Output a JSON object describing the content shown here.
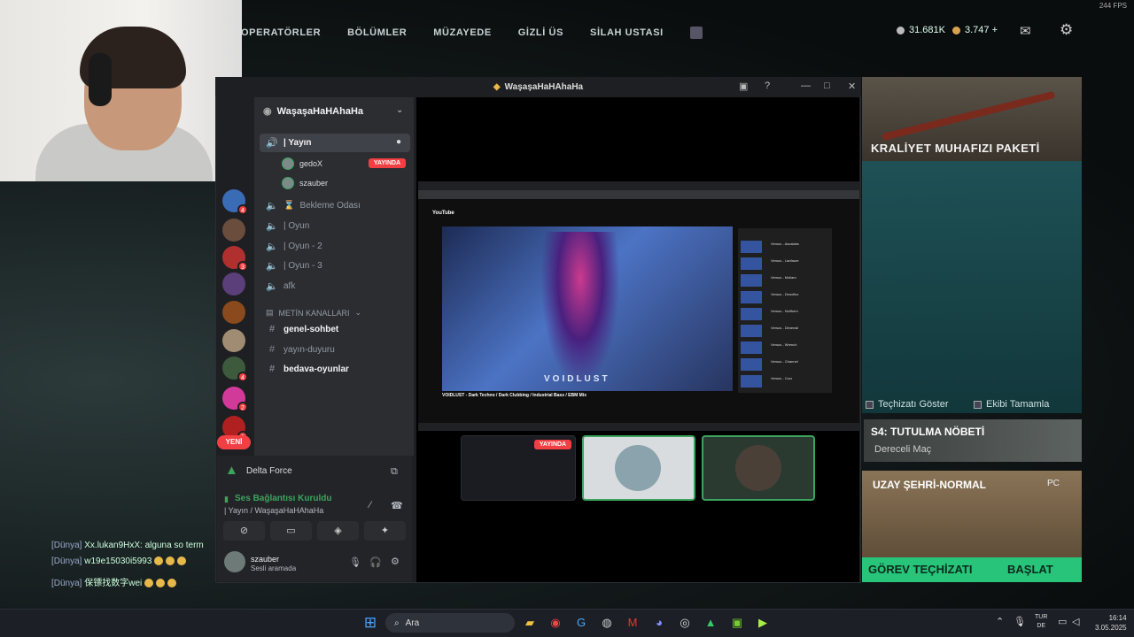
{
  "game": {
    "fps": "244 FPS",
    "nav": [
      "OPERATÖRLER",
      "BÖLÜMLER",
      "MÜZAYEDE",
      "GİZLİ ÜS",
      "SİLAH USTASI"
    ],
    "currency1": "31.681K",
    "currency2": "3.747 +",
    "bundle_title": "KRALİYET MUHAFIZI PAKETİ",
    "show_gear": "Teçhizatı Göster",
    "fill_team": "Ekibi Tamamla",
    "tutorial_title": "S4: TUTULMA NÖBETİ",
    "tutorial_sub": "Dereceli Maç",
    "mode_title": "UZAY ŞEHRİ-NORMAL",
    "mode_platform": "PC",
    "gear_label": "GÖREV TEÇHİZATI",
    "start_label": "BAŞLAT",
    "chat": [
      {
        "prefix": "[Dünya]",
        "text": "Xx.lukan9HxX: alguna so term"
      },
      {
        "prefix": "[Dünya]",
        "text": "w19e15030i5993"
      },
      {
        "prefix": "[Dünya]",
        "text": "保镖找数字wei"
      }
    ]
  },
  "discord": {
    "window_title": "WaşaşaHaHAhaHa",
    "server_name": "WaşaşaHaHAhaHa",
    "channels": {
      "yayin": "| Yayın",
      "bekleme": "Bekleme Odası",
      "oyun": "| Oyun",
      "oyun2": "| Oyun - 2",
      "oyun3": "| Oyun - 3",
      "afk": "afk",
      "text_category": "METİN KANALLARI",
      "genel": "genel-sohbet",
      "duyuru": "yayın-duyuru",
      "bedava": "bedava-oyunlar"
    },
    "voice_users": [
      {
        "name": "gedoX",
        "badge": "YAYINDA"
      },
      {
        "name": "szauber",
        "badge": ""
      }
    ],
    "guild_badges": [
      "4",
      "3",
      "4",
      "2",
      "1"
    ],
    "new_label": "YENİ",
    "activity": "Delta Force",
    "voice_status": "Ses Bağlantısı Kuruldu",
    "voice_channel": "| Yayın / WaşaşaHaHAhaHa",
    "user_name": "szauber",
    "user_status": "Sesli aramada",
    "tile_live": "YAYINDA"
  },
  "stream": {
    "yt_logo": "YouTube",
    "video_overlay": "VOIDLUST",
    "video_title": "VOIDLUST - Dark Techno / Dark Clubbing / Industrial Bass / EBM Mix",
    "playlist": [
      "Versus - Ascalabs",
      "Versus - Lanfaure",
      "Versus - Mollam",
      "Versus - Deuxflux",
      "Versus - Nullform",
      "Versus - Dimensil",
      "Versus - Wrench",
      "Versus - Channel",
      "Versus - Crux"
    ]
  },
  "taskbar": {
    "search_placeholder": "Ara",
    "lang": "TUR",
    "lang2": "DE",
    "time": "16:14",
    "date": "3.05.2025"
  }
}
